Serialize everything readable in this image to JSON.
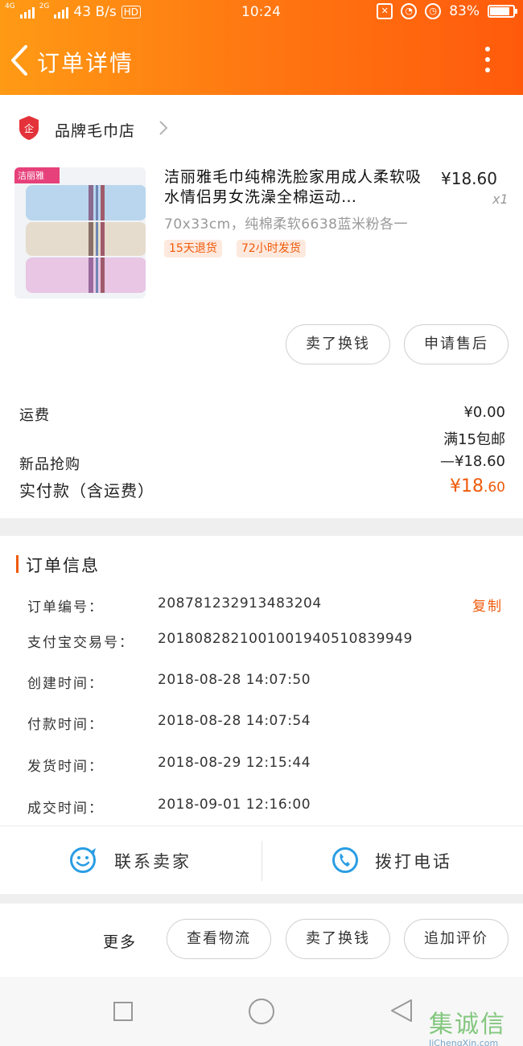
{
  "status_bar": {
    "network_left": "4G",
    "network_right": "2G",
    "speed": "43 B/s",
    "hd": "HD",
    "time": "10:24",
    "battery": "83%"
  },
  "header": {
    "title": "订单详情"
  },
  "store": {
    "name": "品牌毛巾店"
  },
  "product": {
    "title": "洁丽雅毛巾纯棉洗脸家用成人柔软吸水情侣男女洗澡全棉运动…",
    "price": "¥18.60",
    "quantity": "x1",
    "sku": "70x33cm，纯棉柔软6638蓝米粉各一",
    "tags": [
      "15天退货",
      "72小时发货"
    ],
    "brand_logo_text": "洁丽雅"
  },
  "product_actions": {
    "sell_label": "卖了换钱",
    "after_sale_label": "申请售后"
  },
  "fees": {
    "shipping_label": "运费",
    "shipping_value": "¥0.00",
    "shipping_note": "满15包邮",
    "promo_label": "新品抢购",
    "promo_value": "—¥18.60",
    "total_label": "实付款（含运费）",
    "total_value_main": "¥18",
    "total_value_cents": ".60"
  },
  "order_info": {
    "title": "订单信息",
    "copy_label": "复制",
    "rows": [
      {
        "label": "订单编号：",
        "value": "208781232913483204"
      },
      {
        "label": "支付宝交易号：",
        "value": "2018082821001001940510839949"
      },
      {
        "label": "创建时间：",
        "value": "2018-08-28  14:07:50"
      },
      {
        "label": "付款时间：",
        "value": "2018-08-28  14:07:54"
      },
      {
        "label": "发货时间：",
        "value": "2018-08-29  12:15:44"
      },
      {
        "label": "成交时间：",
        "value": "2018-09-01  12:16:00"
      }
    ]
  },
  "contact": {
    "seller_label": "联系卖家",
    "phone_label": "拨打电话"
  },
  "bottom_actions": {
    "more_label": "更多",
    "logistics_label": "查看物流",
    "sell_label": "卖了换钱",
    "review_label": "追加评价"
  },
  "watermark": {
    "text": "集诚信",
    "url": "JiChengXin.com"
  },
  "colors": {
    "accent": "#f05a0a",
    "header_start": "#ff9a14",
    "header_end": "#ff5a0c",
    "divider": "#efefef"
  }
}
